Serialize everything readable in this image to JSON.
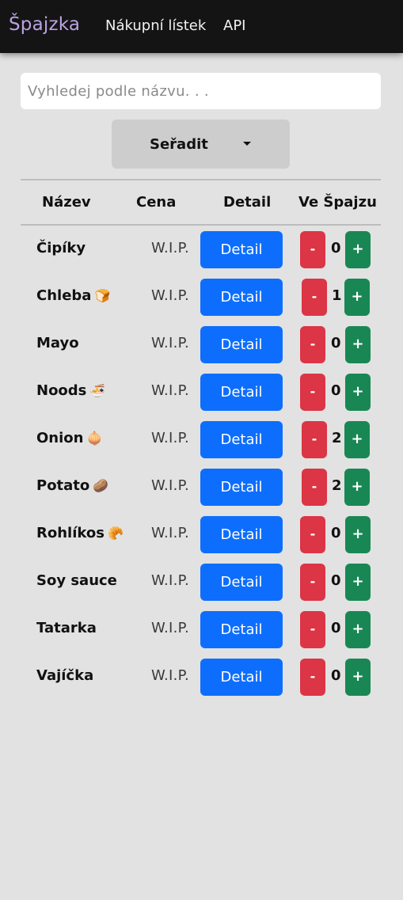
{
  "navbar": {
    "brand": "Špajzka",
    "links": [
      "Nákupní lístek",
      "API"
    ]
  },
  "search": {
    "placeholder": "Vyhledej podle názvu. . .",
    "value": ""
  },
  "sort": {
    "label": "Seřadit"
  },
  "table": {
    "headers": [
      "Název",
      "Cena",
      "Detail",
      "Ve Špajzu"
    ],
    "rows": [
      {
        "name": "Čipíky",
        "emoji": "",
        "price": "W.I.P.",
        "detail": "Detail",
        "minus": "-",
        "qty": "0",
        "plus": "+"
      },
      {
        "name": "Chleba",
        "emoji": "🍞",
        "price": "W.I.P.",
        "detail": "Detail",
        "minus": "-",
        "qty": "1",
        "plus": "+"
      },
      {
        "name": "Mayo",
        "emoji": "",
        "price": "W.I.P.",
        "detail": "Detail",
        "minus": "-",
        "qty": "0",
        "plus": "+"
      },
      {
        "name": "Noods",
        "emoji": "🍜",
        "price": "W.I.P.",
        "detail": "Detail",
        "minus": "-",
        "qty": "0",
        "plus": "+"
      },
      {
        "name": "Onion",
        "emoji": "🧅",
        "price": "W.I.P.",
        "detail": "Detail",
        "minus": "-",
        "qty": "2",
        "plus": "+"
      },
      {
        "name": "Potato",
        "emoji": "🥔",
        "price": "W.I.P.",
        "detail": "Detail",
        "minus": "-",
        "qty": "2",
        "plus": "+"
      },
      {
        "name": "Rohlíkos",
        "emoji": "🥐",
        "price": "W.I.P.",
        "detail": "Detail",
        "minus": "-",
        "qty": "0",
        "plus": "+"
      },
      {
        "name": "Soy sauce",
        "emoji": "",
        "price": "W.I.P.",
        "detail": "Detail",
        "minus": "-",
        "qty": "0",
        "plus": "+"
      },
      {
        "name": "Tatarka",
        "emoji": "",
        "price": "W.I.P.",
        "detail": "Detail",
        "minus": "-",
        "qty": "0",
        "plus": "+"
      },
      {
        "name": "Vajíčka",
        "emoji": "",
        "price": "W.I.P.",
        "detail": "Detail",
        "minus": "-",
        "qty": "0",
        "plus": "+"
      }
    ]
  },
  "colors": {
    "navbar_bg": "#141414",
    "brand": "#b9a3e3",
    "page_bg": "#e2e2e2",
    "detail_button": "#0d6efd",
    "minus_button": "#dc3545",
    "plus_button": "#198754",
    "sort_button": "#cdcdcd"
  }
}
